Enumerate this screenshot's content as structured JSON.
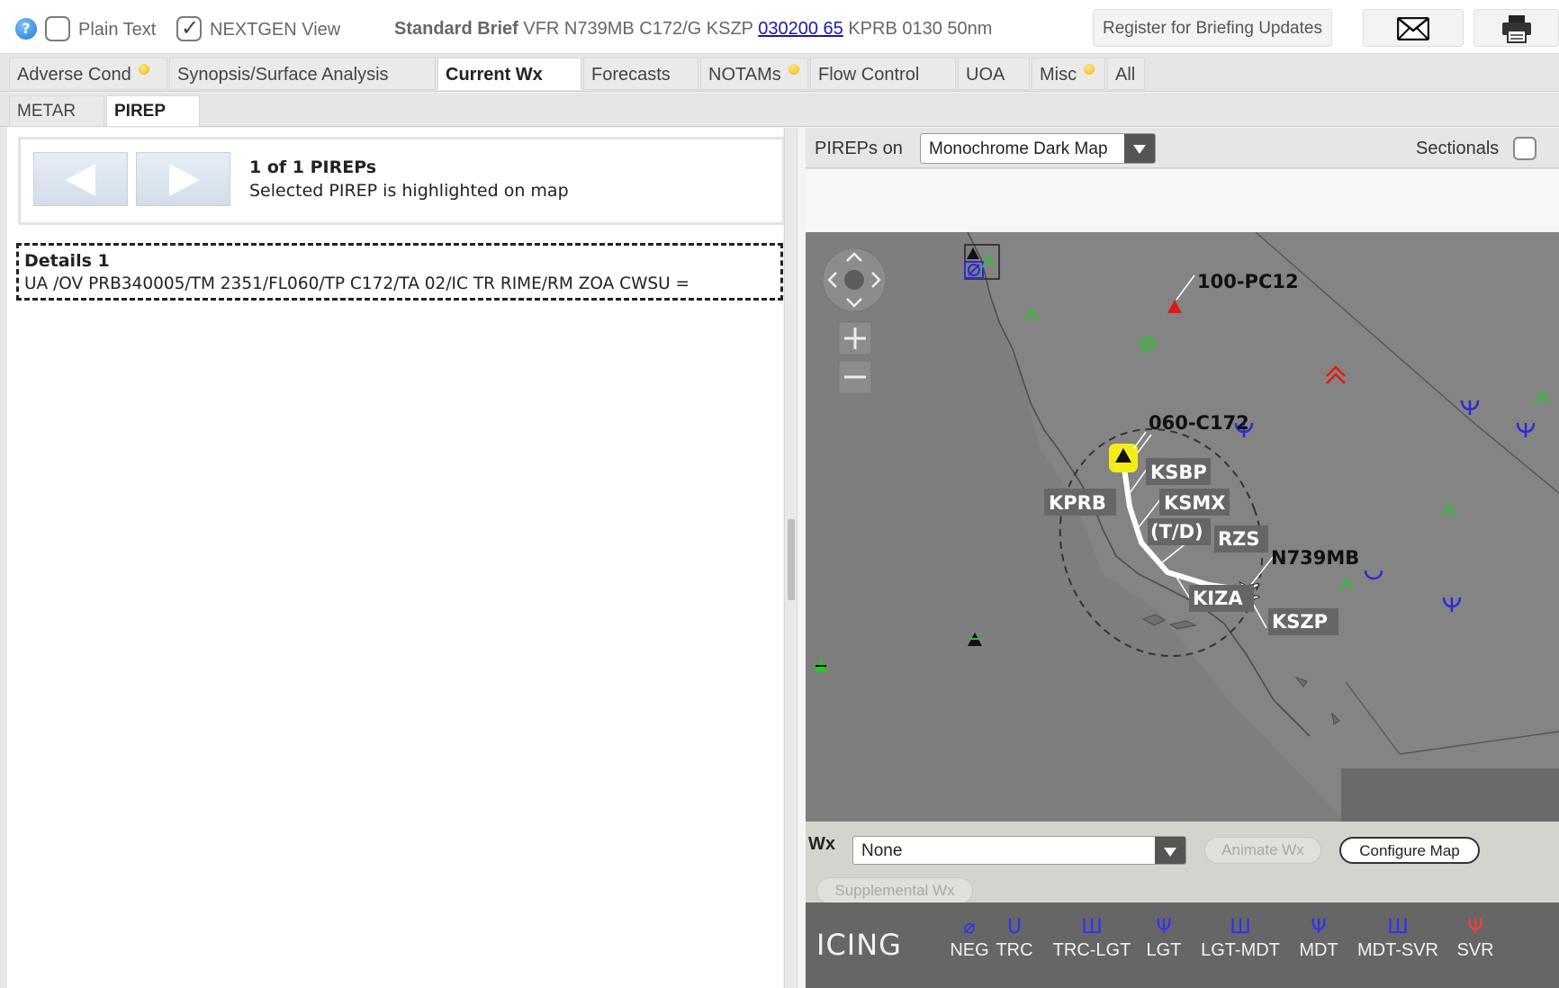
{
  "topbar": {
    "plain_text_label": "Plain Text",
    "plain_text_checked": false,
    "nextgen_label": "NEXTGEN View",
    "nextgen_checked": true,
    "brief_type": "Standard Brief",
    "brief_pre": "VFR N739MB C172/G KSZP",
    "brief_link": "030200 65",
    "brief_post": "KPRB 0130 50nm",
    "register_label": "Register for Briefing Updates",
    "email_icon": "envelope-icon",
    "print_icon": "printer-icon"
  },
  "tabs": [
    {
      "label": "Adverse Cond",
      "dot": true,
      "active": false
    },
    {
      "label": "Synopsis/Surface Analysis",
      "dot": false,
      "active": false
    },
    {
      "label": "Current Wx",
      "dot": false,
      "active": true
    },
    {
      "label": "Forecasts",
      "dot": false,
      "active": false
    },
    {
      "label": "NOTAMs",
      "dot": true,
      "active": false
    },
    {
      "label": "Flow Control",
      "dot": false,
      "active": false
    },
    {
      "label": "UOA",
      "dot": false,
      "active": false
    },
    {
      "label": "Misc",
      "dot": true,
      "active": false
    },
    {
      "label": "All",
      "dot": false,
      "active": false
    }
  ],
  "subtabs": [
    {
      "label": "METAR",
      "active": false
    },
    {
      "label": "PIREP",
      "active": true
    }
  ],
  "pirep_nav": {
    "count_text": "1 of 1 PIREPs",
    "info_text": "Selected PIREP is highlighted on map"
  },
  "details": {
    "title": "Details 1",
    "text": "UA /OV PRB340005/TM 2351/FL060/TP C172/TA 02/IC TR RIME/RM ZOA CWSU ="
  },
  "map_panel": {
    "pireps_on_label": "PIREPs on",
    "basemap_value": "Monochrome Dark Map",
    "sectionals_label": "Sectionals",
    "sectionals_checked": false,
    "map_labels": {
      "pirep_100": "100-PC12",
      "pirep_060": "060-C172",
      "ksbp": "KSBP",
      "kprb": "KPRB",
      "ksmx": "KSMX",
      "td": "(T/D)",
      "rzs": "RZS",
      "n739mb": "N739MB",
      "kiza": "KIZA",
      "kszp": "KSZP"
    },
    "wx_label": "Wx",
    "wx_value": "None",
    "animate_label": "Animate Wx",
    "configure_label": "Configure Map",
    "supplemental_label": "Supplemental Wx"
  },
  "legend": {
    "title": "ICING",
    "items": [
      {
        "label": "NEG",
        "symbol": "⌀",
        "color": "#2b2bd9"
      },
      {
        "label": "TRC",
        "symbol": "U",
        "color": "#2b2bd9"
      },
      {
        "label": "TRC-LGT",
        "symbol": "Ш",
        "color": "#2b2bd9"
      },
      {
        "label": "LGT",
        "symbol": "Ψ",
        "color": "#2b2bd9"
      },
      {
        "label": "LGT-MDT",
        "symbol": "Ш",
        "color": "#2b2bd9"
      },
      {
        "label": "MDT",
        "symbol": "Ψ",
        "color": "#2b2bd9"
      },
      {
        "label": "MDT-SVR",
        "symbol": "Ш",
        "color": "#2b2bd9"
      },
      {
        "label": "SVR",
        "symbol": "Ψ",
        "color": "#e02424"
      }
    ]
  }
}
